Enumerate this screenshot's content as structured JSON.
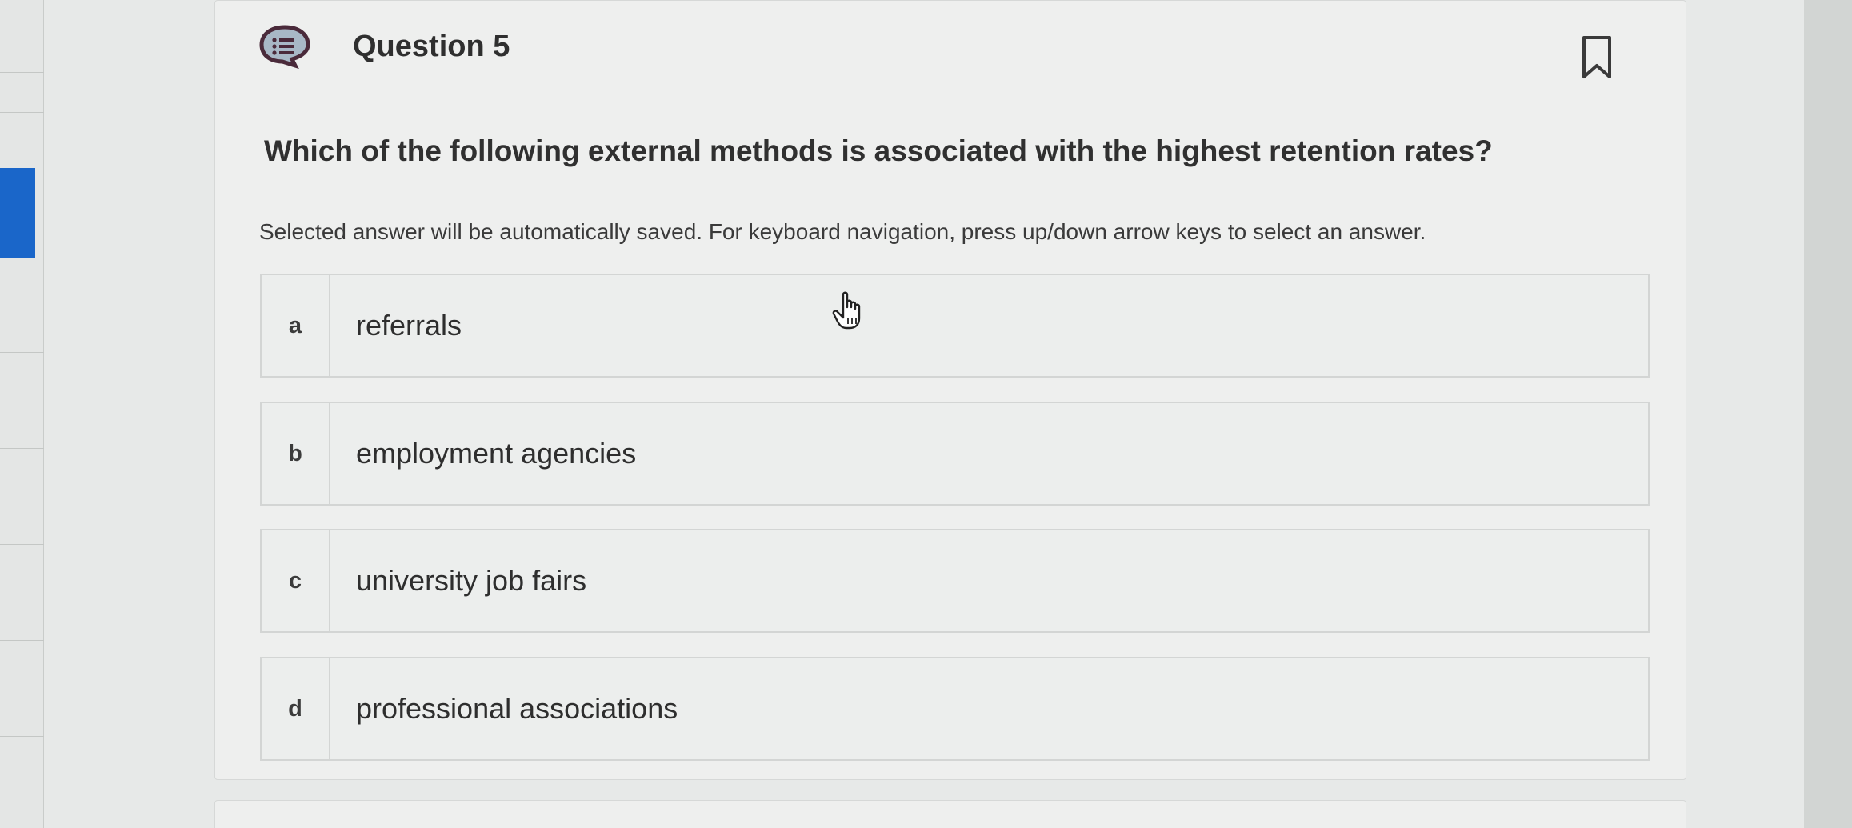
{
  "question": {
    "icon": "question-list-bubble-icon",
    "title": "Question 5",
    "text": "Which of the following external methods is associated with the highest retention rates?",
    "instructions": "Selected answer will be automatically saved. For keyboard navigation, press up/down arrow keys to select an answer.",
    "bookmark_icon": "bookmark-icon"
  },
  "options": [
    {
      "letter": "a",
      "text": "referrals"
    },
    {
      "letter": "b",
      "text": "employment agencies"
    },
    {
      "letter": "c",
      "text": "university job fairs"
    },
    {
      "letter": "d",
      "text": "professional associations"
    }
  ],
  "colors": {
    "accent": "#1a66c9",
    "icon_fill": "#a8b8c6",
    "icon_stroke": "#4a2a3a",
    "text": "#303030"
  },
  "cursor_icon": "hand-pointer-icon"
}
